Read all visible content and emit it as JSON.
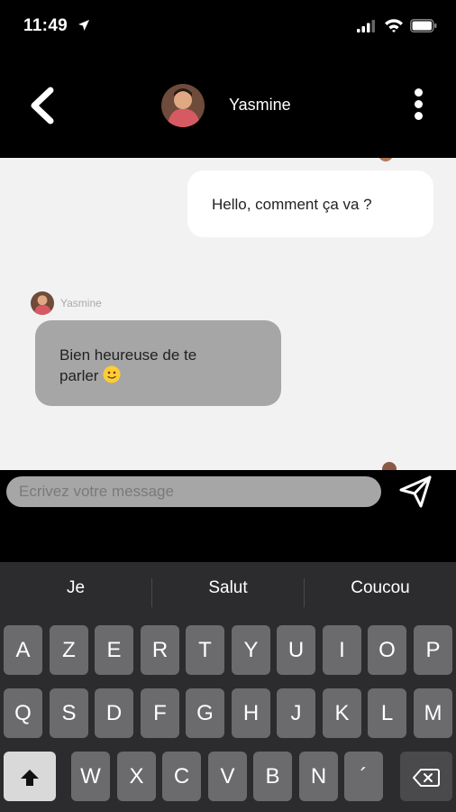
{
  "status_bar": {
    "time": "11:49"
  },
  "header": {
    "contact_name": "Yasmine"
  },
  "messages": {
    "outgoing": [
      {
        "text": "Hello, comment ça va ?"
      }
    ],
    "incoming": [
      {
        "sender": "Yasmine",
        "line1": "Bien heureuse de te",
        "line2": "parler"
      }
    ]
  },
  "composer": {
    "placeholder": "Ecrivez votre message"
  },
  "keyboard": {
    "suggestions": [
      "Je",
      "Salut",
      "Coucou"
    ],
    "row1": [
      "A",
      "Z",
      "E",
      "R",
      "T",
      "Y",
      "U",
      "I",
      "O",
      "P"
    ],
    "row2": [
      "Q",
      "S",
      "D",
      "F",
      "G",
      "H",
      "J",
      "K",
      "L",
      "M"
    ],
    "row3": [
      "W",
      "X",
      "C",
      "V",
      "B",
      "N",
      "´"
    ]
  },
  "colors": {
    "chat_background": "#f2f2f2",
    "incoming_bubble": "#a6a6a6",
    "outgoing_bubble": "#ffffff",
    "keyboard": "#2c2c2e"
  }
}
